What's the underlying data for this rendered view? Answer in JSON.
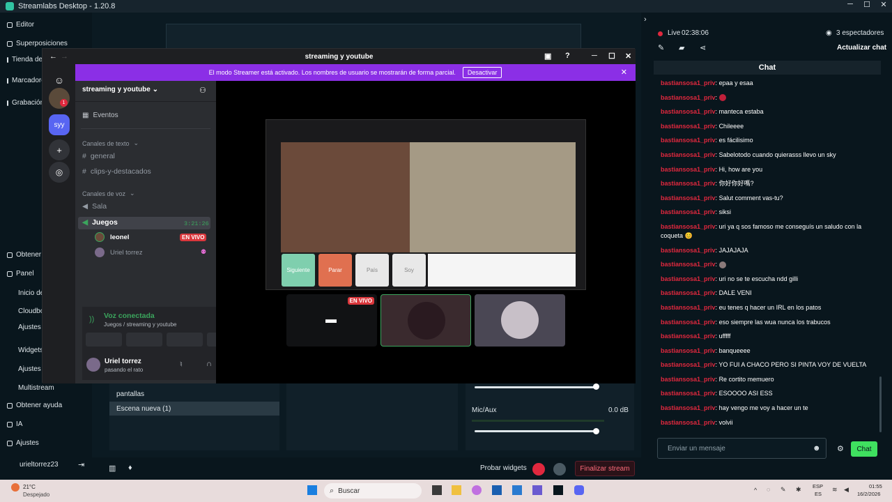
{
  "app": {
    "title": "Streamlabs Desktop - 1.20.8"
  },
  "sidebar": {
    "items": [
      {
        "label": "Editor"
      },
      {
        "label": "Superposiciones"
      },
      {
        "label": "Tienda de aplicación"
      },
      {
        "label": "Marcadores resaltados"
      },
      {
        "label": "Grabación"
      }
    ],
    "lower": [
      {
        "label": "Obtener"
      },
      {
        "label": "Panel"
      },
      {
        "label": "Inicio de"
      },
      {
        "label": "Cloudbo"
      },
      {
        "label": "Ajustes alertas"
      },
      {
        "label": "Widgets"
      },
      {
        "label": "Ajustes"
      },
      {
        "label": "Multistream"
      },
      {
        "label": "Obtener ayuda"
      },
      {
        "label": "IA"
      },
      {
        "label": "Ajustes"
      }
    ],
    "user": "urieltorrez23"
  },
  "scenes": {
    "items": [
      "pantallas",
      "Escena nueva (1)"
    ]
  },
  "mixer": {
    "label": "Mic/Aux",
    "value": "0.0 dB"
  },
  "bottom": {
    "test_widgets": "Probar widgets",
    "finish": "Finalizar stream"
  },
  "status": {
    "live": "Live",
    "time": "02:38:06",
    "viewers": "3 espectadores",
    "refresh": "Actualizar chat"
  },
  "chat": {
    "title": "Chat",
    "messages": [
      {
        "user": "bastiansosa1_priv",
        "text": "epaa y esaa"
      },
      {
        "user": "bastiansosa1_priv",
        "text": ""
      },
      {
        "user": "bastiansosa1_priv",
        "text": "manteca estaba"
      },
      {
        "user": "bastiansosa1_priv",
        "text": "Chileeee"
      },
      {
        "user": "bastiansosa1_priv",
        "text": "es fácilisimo"
      },
      {
        "user": "bastiansosa1_priv",
        "text": "Sabelotodo cuando quierasss llevo un sky"
      },
      {
        "user": "bastiansosa1_priv",
        "text": "Hi, how are you"
      },
      {
        "user": "bastiansosa1_priv",
        "text": "你好你好嗎?"
      },
      {
        "user": "bastiansosa1_priv",
        "text": "Salut comment vas-tu?"
      },
      {
        "user": "bastiansosa1_priv",
        "text": "siksi"
      },
      {
        "user": "bastiansosa1_priv",
        "text": "uri ya q sos famoso me conseguís un saludo con la coqueta 😊"
      },
      {
        "user": "bastiansosa1_priv",
        "text": "JAJAJAJA"
      },
      {
        "user": "bastiansosa1_priv",
        "text": ""
      },
      {
        "user": "bastiansosa1_priv",
        "text": "uri no se te escucha ndd gilli"
      },
      {
        "user": "bastiansosa1_priv",
        "text": "DALE VENI"
      },
      {
        "user": "bastiansosa1_priv",
        "text": "eu tenes q hacer un IRL en los patos"
      },
      {
        "user": "bastiansosa1_priv",
        "text": "eso siempre las wua nunca los trabucos"
      },
      {
        "user": "bastiansosa1_priv",
        "text": "ufffff"
      },
      {
        "user": "bastiansosa1_priv",
        "text": "banqueeee"
      },
      {
        "user": "bastiansosa1_priv",
        "text": "YO FUI A CHACO PERO SI PINTA VOY DE VUELTA"
      },
      {
        "user": "bastiansosa1_priv",
        "text": "Re cortito memuero"
      },
      {
        "user": "bastiansosa1_priv",
        "text": "ESOOOO ASI ESS"
      },
      {
        "user": "bastiansosa1_priv",
        "text": "hay vengo me voy a hacer un te"
      },
      {
        "user": "bastiansosa1_priv",
        "text": "volvii"
      }
    ],
    "input_placeholder": "Enviar un mensaje",
    "send": "Chat"
  },
  "discord": {
    "title": "streaming y youtube",
    "banner": "El modo Streamer está activado. Los nombres de usuario se mostrarán de forma parcial.",
    "banner_button": "Desactivar",
    "server": "streaming y youtube",
    "server_icon": "syy",
    "events": "Eventos",
    "text_category": "Canales de texto",
    "text_channels": [
      "general",
      "clips-y-destacados"
    ],
    "voice_category": "Canales de voz",
    "voice_channels": [
      "Sala",
      "Juegos"
    ],
    "voice_timer": "3:21:26",
    "voice_users": [
      {
        "name": "leonel",
        "badge": "EN VIVO"
      },
      {
        "name": "Uriel torrez"
      }
    ],
    "voice_status": "Voz conectada",
    "voice_path": "Juegos / streaming y youtube",
    "user": {
      "name": "Uriel torrez",
      "status": "pasando el rato"
    },
    "stage_live": "EN VIVO",
    "stream_buttons": [
      "Siguiente",
      "Parar",
      "País",
      "Soy"
    ]
  },
  "taskbar": {
    "weather_temp": "21°C",
    "weather_desc": "Despejado",
    "search": "Buscar",
    "lang": "ESP",
    "lang2": "ES",
    "time": "01:55",
    "date": "16/2/2026"
  },
  "colors": {
    "live": "#e0283e",
    "accent": "#80f5d2",
    "discord_purple": "#8b2fe6"
  }
}
